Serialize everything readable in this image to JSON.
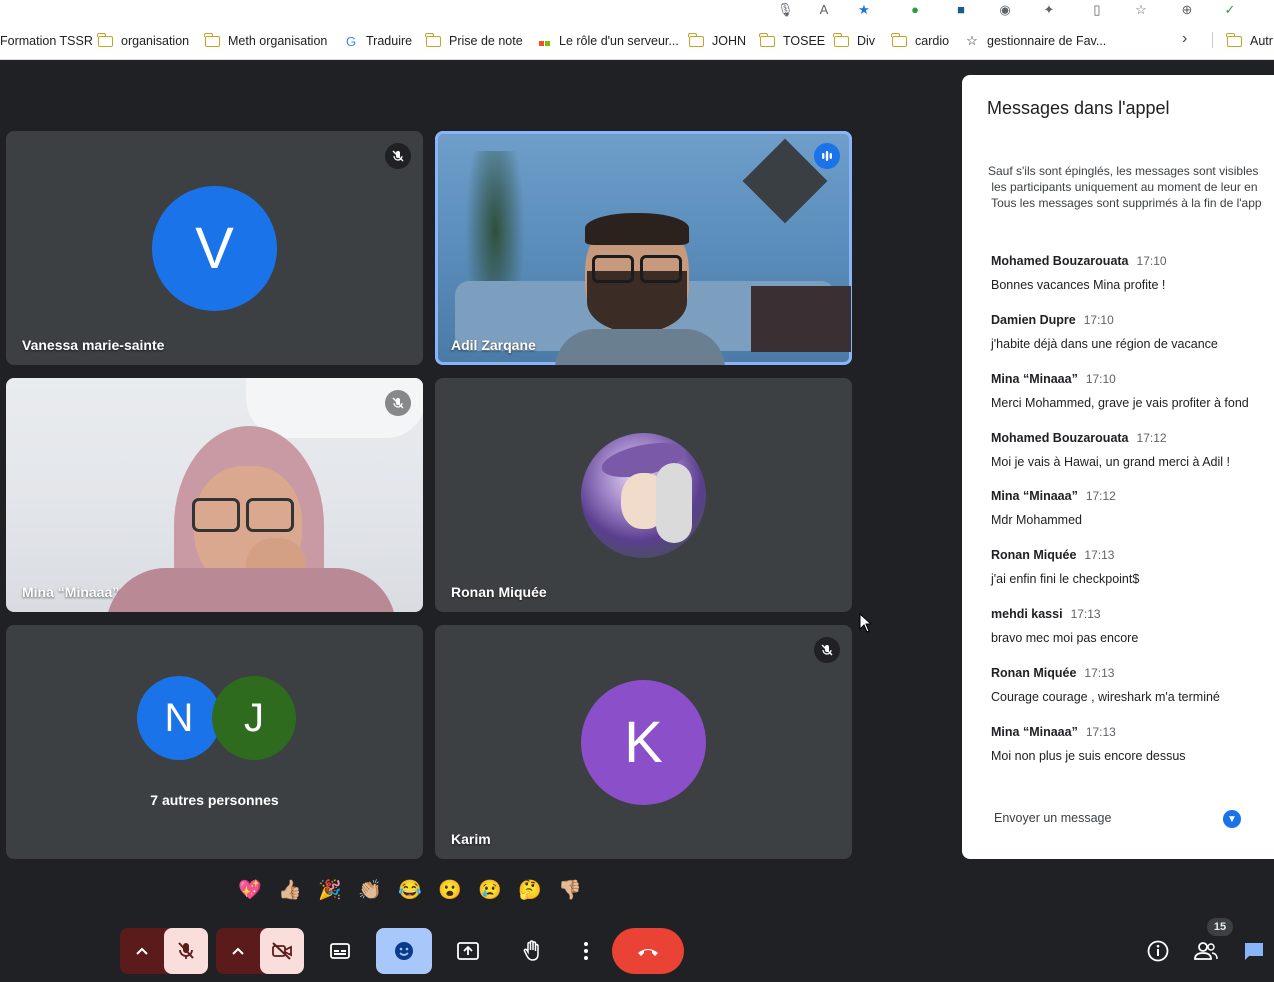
{
  "bookmarks": {
    "items": [
      {
        "label": "Formation TSSR",
        "icon": "none"
      },
      {
        "label": "organisation",
        "icon": "folder-icon"
      },
      {
        "label": "Meth organisation",
        "icon": "folder-icon"
      },
      {
        "label": "Traduire",
        "icon": "translate-icon"
      },
      {
        "label": "Prise de note",
        "icon": "folder-icon"
      },
      {
        "label": "Le rôle d'un serveur...",
        "icon": "microsoft-icon"
      },
      {
        "label": "JOHN",
        "icon": "folder-icon"
      },
      {
        "label": "TOSEE",
        "icon": "folder-icon"
      },
      {
        "label": "Div",
        "icon": "folder-icon"
      },
      {
        "label": "cardio",
        "icon": "folder-icon"
      },
      {
        "label": "gestionnaire de Fav...",
        "icon": "star-icon"
      },
      {
        "label": "Autr",
        "icon": "folder-icon"
      }
    ]
  },
  "tiles": {
    "vanessa": {
      "name": "Vanessa marie-sainte",
      "initial": "V",
      "color": "#1a73e8"
    },
    "adil": {
      "name": "Adil Zarqane"
    },
    "mina": {
      "name": "Mina “Minaaa”"
    },
    "ronan": {
      "name": "Ronan Miquée"
    },
    "others": {
      "label": "7 autres personnes",
      "initials": [
        "N",
        "J"
      ],
      "colors": [
        "#1a73e8",
        "#2e6b1f"
      ]
    },
    "karim": {
      "name": "Karim",
      "initial": "K",
      "color": "#8a4fc9"
    }
  },
  "chat": {
    "title": "Messages dans l'appel",
    "info": [
      "Sauf s'ils sont épinglés, les messages sont visibles",
      " les participants uniquement au moment de leur en",
      " Tous les messages sont supprimés à la fin de l'app"
    ],
    "messages": [
      {
        "author": "Mohamed Bouzarouata",
        "time": "17:10",
        "text": "Bonnes vacances Mina profite !"
      },
      {
        "author": "Damien Dupre",
        "time": "17:10",
        "text": "j'habite déjà dans une région de vacance"
      },
      {
        "author": "Mina “Minaaa”",
        "time": "17:10",
        "text": "Merci Mohammed, grave je vais profiter à fond"
      },
      {
        "author": "Mohamed Bouzarouata",
        "time": "17:12",
        "text": "Moi je vais à Hawai, un grand merci à Adil !"
      },
      {
        "author": "Mina “Minaaa”",
        "time": "17:12",
        "text": "Mdr Mohammed"
      },
      {
        "author": "Ronan Miquée",
        "time": "17:13",
        "text": "j'ai enfin fini le checkpoint$"
      },
      {
        "author": "mehdi kassi",
        "time": "17:13",
        "text": "bravo mec moi pas encore"
      },
      {
        "author": "Ronan Miquée",
        "time": "17:13",
        "text": "Courage courage , wireshark m'a terminé"
      },
      {
        "author": "Mina “Minaaa”",
        "time": "17:13",
        "text": "Moi non plus je suis encore dessus"
      }
    ],
    "compose_placeholder": "Envoyer un message"
  },
  "reactions": [
    "💖",
    "👍🏼",
    "🎉",
    "👏🏼",
    "😂",
    "😮",
    "😢",
    "🤔",
    "👎🏼"
  ],
  "controls": {
    "participants_count": "15",
    "accent_colors": {
      "end_call": "#ea4335",
      "active_mute": "#f9dedc",
      "emoji_active": "#a8c7fa"
    }
  }
}
